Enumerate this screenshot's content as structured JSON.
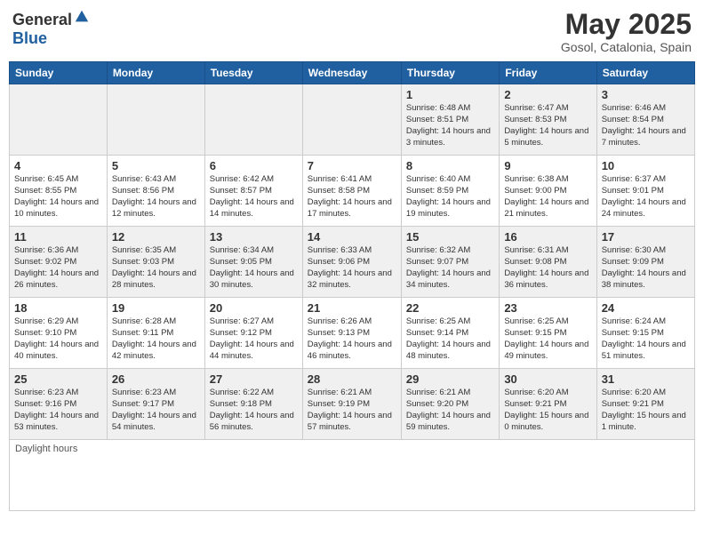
{
  "header": {
    "logo_general": "General",
    "logo_blue": "Blue",
    "title": "May 2025",
    "subtitle": "Gosol, Catalonia, Spain"
  },
  "calendar": {
    "days_of_week": [
      "Sunday",
      "Monday",
      "Tuesday",
      "Wednesday",
      "Thursday",
      "Friday",
      "Saturday"
    ],
    "weeks": [
      [
        {
          "day": "",
          "info": ""
        },
        {
          "day": "",
          "info": ""
        },
        {
          "day": "",
          "info": ""
        },
        {
          "day": "",
          "info": ""
        },
        {
          "day": "1",
          "info": "Sunrise: 6:48 AM\nSunset: 8:51 PM\nDaylight: 14 hours and 3 minutes."
        },
        {
          "day": "2",
          "info": "Sunrise: 6:47 AM\nSunset: 8:53 PM\nDaylight: 14 hours and 5 minutes."
        },
        {
          "day": "3",
          "info": "Sunrise: 6:46 AM\nSunset: 8:54 PM\nDaylight: 14 hours and 7 minutes."
        }
      ],
      [
        {
          "day": "4",
          "info": "Sunrise: 6:45 AM\nSunset: 8:55 PM\nDaylight: 14 hours and 10 minutes."
        },
        {
          "day": "5",
          "info": "Sunrise: 6:43 AM\nSunset: 8:56 PM\nDaylight: 14 hours and 12 minutes."
        },
        {
          "day": "6",
          "info": "Sunrise: 6:42 AM\nSunset: 8:57 PM\nDaylight: 14 hours and 14 minutes."
        },
        {
          "day": "7",
          "info": "Sunrise: 6:41 AM\nSunset: 8:58 PM\nDaylight: 14 hours and 17 minutes."
        },
        {
          "day": "8",
          "info": "Sunrise: 6:40 AM\nSunset: 8:59 PM\nDaylight: 14 hours and 19 minutes."
        },
        {
          "day": "9",
          "info": "Sunrise: 6:38 AM\nSunset: 9:00 PM\nDaylight: 14 hours and 21 minutes."
        },
        {
          "day": "10",
          "info": "Sunrise: 6:37 AM\nSunset: 9:01 PM\nDaylight: 14 hours and 24 minutes."
        }
      ],
      [
        {
          "day": "11",
          "info": "Sunrise: 6:36 AM\nSunset: 9:02 PM\nDaylight: 14 hours and 26 minutes."
        },
        {
          "day": "12",
          "info": "Sunrise: 6:35 AM\nSunset: 9:03 PM\nDaylight: 14 hours and 28 minutes."
        },
        {
          "day": "13",
          "info": "Sunrise: 6:34 AM\nSunset: 9:05 PM\nDaylight: 14 hours and 30 minutes."
        },
        {
          "day": "14",
          "info": "Sunrise: 6:33 AM\nSunset: 9:06 PM\nDaylight: 14 hours and 32 minutes."
        },
        {
          "day": "15",
          "info": "Sunrise: 6:32 AM\nSunset: 9:07 PM\nDaylight: 14 hours and 34 minutes."
        },
        {
          "day": "16",
          "info": "Sunrise: 6:31 AM\nSunset: 9:08 PM\nDaylight: 14 hours and 36 minutes."
        },
        {
          "day": "17",
          "info": "Sunrise: 6:30 AM\nSunset: 9:09 PM\nDaylight: 14 hours and 38 minutes."
        }
      ],
      [
        {
          "day": "18",
          "info": "Sunrise: 6:29 AM\nSunset: 9:10 PM\nDaylight: 14 hours and 40 minutes."
        },
        {
          "day": "19",
          "info": "Sunrise: 6:28 AM\nSunset: 9:11 PM\nDaylight: 14 hours and 42 minutes."
        },
        {
          "day": "20",
          "info": "Sunrise: 6:27 AM\nSunset: 9:12 PM\nDaylight: 14 hours and 44 minutes."
        },
        {
          "day": "21",
          "info": "Sunrise: 6:26 AM\nSunset: 9:13 PM\nDaylight: 14 hours and 46 minutes."
        },
        {
          "day": "22",
          "info": "Sunrise: 6:25 AM\nSunset: 9:14 PM\nDaylight: 14 hours and 48 minutes."
        },
        {
          "day": "23",
          "info": "Sunrise: 6:25 AM\nSunset: 9:15 PM\nDaylight: 14 hours and 49 minutes."
        },
        {
          "day": "24",
          "info": "Sunrise: 6:24 AM\nSunset: 9:15 PM\nDaylight: 14 hours and 51 minutes."
        }
      ],
      [
        {
          "day": "25",
          "info": "Sunrise: 6:23 AM\nSunset: 9:16 PM\nDaylight: 14 hours and 53 minutes."
        },
        {
          "day": "26",
          "info": "Sunrise: 6:23 AM\nSunset: 9:17 PM\nDaylight: 14 hours and 54 minutes."
        },
        {
          "day": "27",
          "info": "Sunrise: 6:22 AM\nSunset: 9:18 PM\nDaylight: 14 hours and 56 minutes."
        },
        {
          "day": "28",
          "info": "Sunrise: 6:21 AM\nSunset: 9:19 PM\nDaylight: 14 hours and 57 minutes."
        },
        {
          "day": "29",
          "info": "Sunrise: 6:21 AM\nSunset: 9:20 PM\nDaylight: 14 hours and 59 minutes."
        },
        {
          "day": "30",
          "info": "Sunrise: 6:20 AM\nSunset: 9:21 PM\nDaylight: 15 hours and 0 minutes."
        },
        {
          "day": "31",
          "info": "Sunrise: 6:20 AM\nSunset: 9:21 PM\nDaylight: 15 hours and 1 minute."
        }
      ]
    ],
    "footnote": "Daylight hours"
  }
}
